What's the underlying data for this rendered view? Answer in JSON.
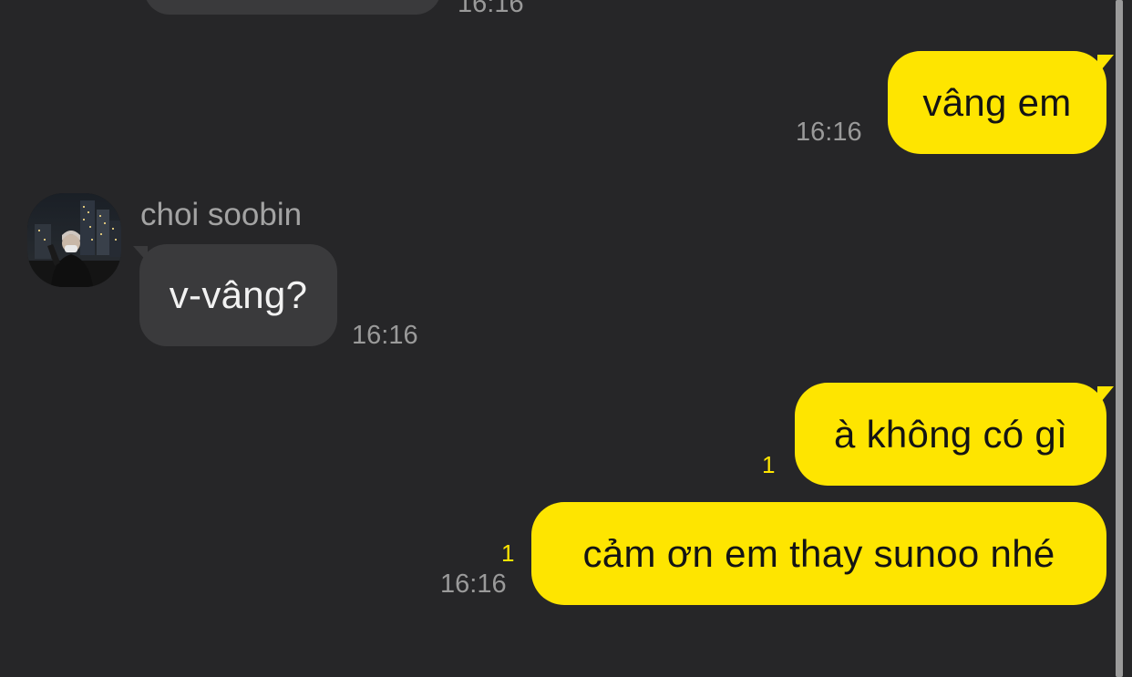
{
  "messages": {
    "prev_time": "16:16",
    "m1": {
      "text": "vâng em",
      "time": "16:16"
    },
    "m2": {
      "sender": "choi soobin",
      "text": "v-vâng?",
      "time": "16:16"
    },
    "m3": {
      "text": "à không có gì",
      "unread": "1"
    },
    "m4": {
      "text": "cảm ơn em thay sunoo nhé",
      "unread": "1",
      "time": "16:16"
    }
  },
  "colors": {
    "background": "#262628",
    "outgoing_bubble": "#fee500",
    "incoming_bubble": "#3a3a3c",
    "unread_count": "#fee500",
    "timestamp": "#9a9a9a"
  },
  "icons": {
    "avatar": "profile-photo-person-in-city-night"
  }
}
